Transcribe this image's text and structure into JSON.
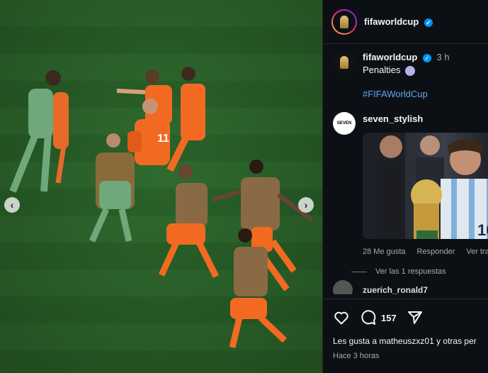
{
  "post": {
    "username": "fifaworldcup",
    "verified_mark": "✓",
    "caption_time": "3 h",
    "caption_text": "Penalties",
    "hashtag": "#FIFAWorldCup",
    "media_icon_prev": "‹",
    "media_icon_next": "›"
  },
  "comment": {
    "username": "seven_stylish",
    "avatar_text": "SEVEN",
    "likes": "28 Me gusta",
    "reply": "Responder",
    "translate": "Ver tra",
    "view_replies": "Ver las 1 respuestas"
  },
  "next_comment": {
    "username": "zuerich_ronald7"
  },
  "footer": {
    "comment_count": "157",
    "liked_by": "Les gusta a matheuszxz01 y otras per",
    "posted_ago": "Hace 3 horas"
  },
  "colors": {
    "link": "#63a7f1",
    "verified": "#0095f6",
    "panel_bg": "#0c1014"
  },
  "icons": [
    "heart-icon",
    "comment-icon",
    "share-icon",
    "trophy-logo"
  ]
}
